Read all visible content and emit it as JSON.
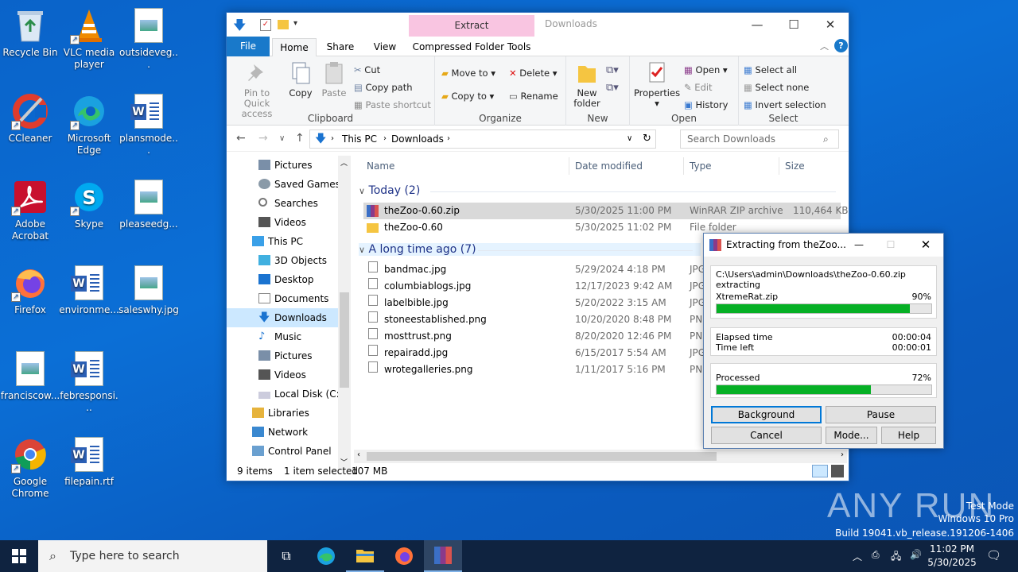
{
  "desktop": {
    "icons": [
      {
        "label": "Recycle Bin"
      },
      {
        "label": "VLC media player"
      },
      {
        "label": "outsideveg..."
      },
      {
        "label": "CCleaner"
      },
      {
        "label": "Microsoft Edge"
      },
      {
        "label": "plansmode..."
      },
      {
        "label": "Adobe Acrobat"
      },
      {
        "label": "Skype"
      },
      {
        "label": "pleaseedg..."
      },
      {
        "label": "Firefox"
      },
      {
        "label": "environme..."
      },
      {
        "label": "saleswhy.jpg"
      },
      {
        "label": "franciscow..."
      },
      {
        "label": "febresponsi..."
      },
      {
        "label": "Google Chrome"
      },
      {
        "label": "filepain.rtf"
      }
    ]
  },
  "explorer": {
    "title": "Downloads",
    "context_tab": "Extract",
    "tabs": {
      "file": "File",
      "home": "Home",
      "share": "Share",
      "view": "View",
      "tools": "Compressed Folder Tools"
    },
    "ribbon": {
      "pin": "Pin to Quick access",
      "copy": "Copy",
      "paste": "Paste",
      "cut": "Cut",
      "copy_path": "Copy path",
      "paste_shortcut": "Paste shortcut",
      "clipboard": "Clipboard",
      "move_to": "Move to",
      "copy_to": "Copy to",
      "delete": "Delete",
      "rename": "Rename",
      "organize": "Organize",
      "new_folder": "New folder",
      "new": "New",
      "properties": "Properties",
      "open_btn": "Open",
      "edit": "Edit",
      "history": "History",
      "open_group": "Open",
      "select_all": "Select all",
      "select_none": "Select none",
      "invert": "Invert selection",
      "select": "Select"
    },
    "breadcrumb": {
      "root": "This PC",
      "current": "Downloads"
    },
    "search_placeholder": "Search Downloads",
    "nav": [
      "Pictures",
      "Saved Games",
      "Searches",
      "Videos",
      "This PC",
      "3D Objects",
      "Desktop",
      "Documents",
      "Downloads",
      "Music",
      "Pictures",
      "Videos",
      "Local Disk (C:)",
      "Libraries",
      "Network",
      "Control Panel"
    ],
    "columns": {
      "name": "Name",
      "date": "Date modified",
      "type": "Type",
      "size": "Size"
    },
    "groups": {
      "today": "Today (2)",
      "older": "A long time ago (7)"
    },
    "files_today": [
      {
        "name": "theZoo-0.60.zip",
        "date": "5/30/2025 11:00 PM",
        "type": "WinRAR ZIP archive",
        "size": "110,464 KB"
      },
      {
        "name": "theZoo-0.60",
        "date": "5/30/2025 11:02 PM",
        "type": "File folder",
        "size": ""
      }
    ],
    "files_old": [
      {
        "name": "bandmac.jpg",
        "date": "5/29/2024 4:18 PM",
        "type": "JPG"
      },
      {
        "name": "columbiablogs.jpg",
        "date": "12/17/2023 9:42 AM",
        "type": "JPG"
      },
      {
        "name": "labelbible.jpg",
        "date": "5/20/2022 3:15 AM",
        "type": "JPG"
      },
      {
        "name": "stoneestablished.png",
        "date": "10/20/2020 8:48 PM",
        "type": "PN"
      },
      {
        "name": "mosttrust.png",
        "date": "8/20/2020 12:46 PM",
        "type": "PN"
      },
      {
        "name": "repairadd.jpg",
        "date": "6/15/2017 5:54 AM",
        "type": "JPG"
      },
      {
        "name": "wrotegalleries.png",
        "date": "1/11/2017 5:16 PM",
        "type": "PN"
      }
    ],
    "status": {
      "items": "9 items",
      "selected": "1 item selected",
      "size": "107 MB"
    }
  },
  "dialog": {
    "title": "Extracting from theZoo...",
    "path": "C:\\Users\\admin\\Downloads\\theZoo-0.60.zip",
    "action": "extracting",
    "current_file": "XtremeRat.zip",
    "file_percent": "90%",
    "file_progress": 0.9,
    "elapsed_label": "Elapsed time",
    "elapsed": "00:00:04",
    "left_label": "Time left",
    "left": "00:00:01",
    "processed_label": "Processed",
    "processed_percent": "72%",
    "processed_progress": 0.72,
    "buttons": {
      "background": "Background",
      "pause": "Pause",
      "cancel": "Cancel",
      "mode": "Mode...",
      "help": "Help"
    }
  },
  "taskbar": {
    "search_placeholder": "Type here to search",
    "time": "11:02 PM",
    "date": "5/30/2025"
  },
  "watermark": {
    "brand": "ANY RUN",
    "mode": "Test Mode",
    "os": "Windows 10 Pro",
    "build": "Build 19041.vb_release.191206-1406"
  }
}
